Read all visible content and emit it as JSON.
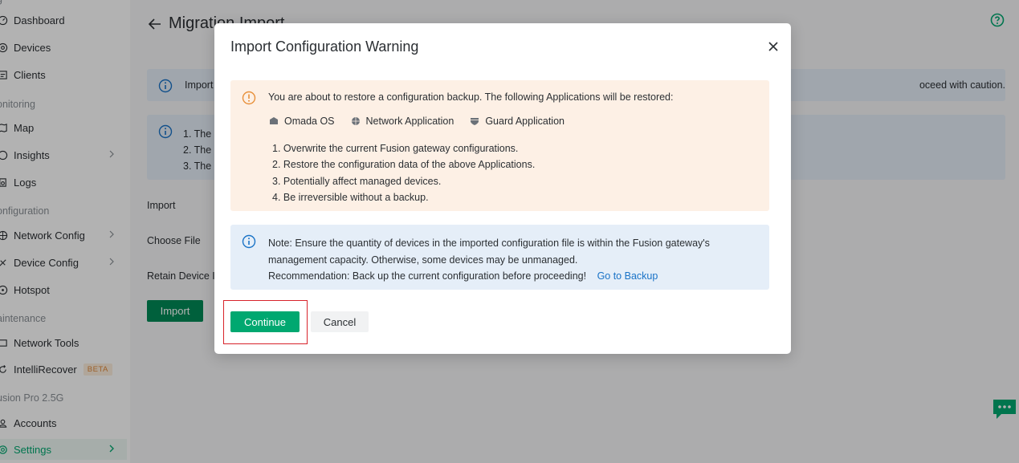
{
  "sidebar": {
    "partial_top_label": "g",
    "items": [
      {
        "label": "Dashboard",
        "icon": "dashboard-icon"
      },
      {
        "label": "Devices",
        "icon": "devices-icon"
      },
      {
        "label": "Clients",
        "icon": "clients-icon"
      }
    ],
    "monitoring_label": "onitoring",
    "monitoring_items": [
      {
        "label": "Map",
        "icon": "map-icon"
      },
      {
        "label": "Insights",
        "icon": "insights-icon"
      },
      {
        "label": "Logs",
        "icon": "logs-icon"
      }
    ],
    "configuration_label": "onfiguration",
    "configuration_items": [
      {
        "label": "Network Config",
        "icon": "network-config-icon"
      },
      {
        "label": "Device Config",
        "icon": "device-config-icon"
      },
      {
        "label": "Hotspot",
        "icon": "hotspot-icon"
      }
    ],
    "maintenance_label": "aintenance",
    "maintenance_items": [
      {
        "label": "Network Tools",
        "icon": "network-tools-icon"
      },
      {
        "label": "IntelliRecover",
        "icon": "intellirecover-icon",
        "badge": "BETA"
      }
    ],
    "device_label": "usion Pro 2.5G",
    "device_items": [
      {
        "label": "Accounts",
        "icon": "accounts-icon"
      },
      {
        "label": "Settings",
        "icon": "settings-icon",
        "active": true
      }
    ]
  },
  "main": {
    "title": "Migration Import",
    "banner1_left": "Import",
    "banner1_right": "oceed with caution.",
    "banner2_lines": [
      "1. The F",
      "2. The F",
      "3. The F"
    ],
    "form_labels": [
      "Import",
      "Choose File",
      "Retain Device In"
    ],
    "import_button": "Import"
  },
  "modal": {
    "title": "Import Configuration Warning",
    "warning_intro": "You are about to restore a configuration backup. The following Applications will be restored:",
    "apps": [
      {
        "label": "Omada OS",
        "icon": "omada-os-icon"
      },
      {
        "label": "Network Application",
        "icon": "network-application-icon"
      },
      {
        "label": "Guard Application",
        "icon": "guard-application-icon"
      }
    ],
    "warning_list": [
      "1. Overwrite the current Fusion gateway configurations.",
      "2. Restore the configuration data of the above Applications.",
      "3. Potentially affect managed devices.",
      "4. Be irreversible without a backup."
    ],
    "note_line1": "Note: Ensure the quantity of devices in the imported configuration file is within the Fusion gateway's",
    "note_line2": "management capacity. Otherwise, some devices may be unmanaged.",
    "note_line3": "Recommendation: Back up the current configuration before proceeding!",
    "note_link": "Go to Backup",
    "continue_label": "Continue",
    "cancel_label": "Cancel"
  },
  "colors": {
    "accent": "#00a870",
    "import_button": "#008a57",
    "warning_bg": "#fdf0e5",
    "info_bg": "#e5eef8",
    "link": "#1a73c7",
    "highlight": "#d8232a"
  }
}
